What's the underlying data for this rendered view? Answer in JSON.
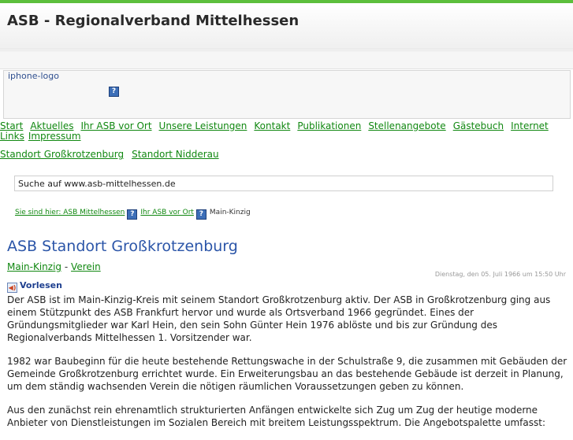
{
  "site": {
    "title": "ASB - Regionalverband Mittelhessen"
  },
  "logo": {
    "alt_text": "iphone-logo"
  },
  "nav": [
    "Start",
    "Aktuelles",
    "Ihr ASB vor Ort",
    "Unsere Leistungen",
    "Kontakt",
    "Publikationen",
    "Stellenangebote",
    "Gästebuch",
    "Internet",
    "Links",
    "Impressum"
  ],
  "subnav": [
    "Standort Großkrotzenburg",
    "Standort Nidderau"
  ],
  "search": {
    "value": "Suche auf www.asb-mittelhessen.de"
  },
  "breadcrumb": {
    "prefix": "Sie sind hier: ASB Mittelhessen",
    "level2": "Ihr ASB vor Ort",
    "current": "Main-Kinzig"
  },
  "article": {
    "title": "ASB Standort Großkrotzenburg",
    "tag1": "Main-Kinzig",
    "tag_sep": "-",
    "tag2": "Verein",
    "date": "Dienstag, den 05. Juli 1966 um 15:50 Uhr",
    "read_aloud": "Vorlesen",
    "paragraphs": [
      "Der ASB ist im Main-Kinzig-Kreis mit seinem Standort Großkrotzenburg aktiv. Der ASB in Großkrotzenburg ging aus einem Stützpunkt des ASB Frankfurt hervor und wurde als Ortsverband 1966 gegründet. Eines der Gründungsmitglieder war Karl Hein, den sein Sohn Günter Hein 1976 ablöste und bis zur Gründung des Regionalverbands Mittelhessen 1. Vorsitzender war.",
      "1982 war Baubeginn für die heute bestehende Rettungswache in der Schulstraße 9, die zusammen mit Gebäuden der Gemeinde Großkrotzenburg errichtet wurde. Ein Erweiterungsbau an das bestehende Gebäude ist derzeit in Planung, um dem ständig wachsenden Verein die nötigen räumlichen Voraussetzungen geben zu können.",
      "Aus den zunächst rein ehrenamtlich strukturierten Anfängen entwickelte sich Zug um Zug der heutige moderne Anbieter von Dienstleistungen im Sozialen Bereich mit breitem Leistungsspektrum. Die Angebotspalette umfasst:"
    ]
  },
  "icons": {
    "help": "?",
    "speaker": "◀)"
  },
  "colors": {
    "link": "#118811",
    "heading": "#2b55a8",
    "accent_bar": "#5cbf3c"
  }
}
